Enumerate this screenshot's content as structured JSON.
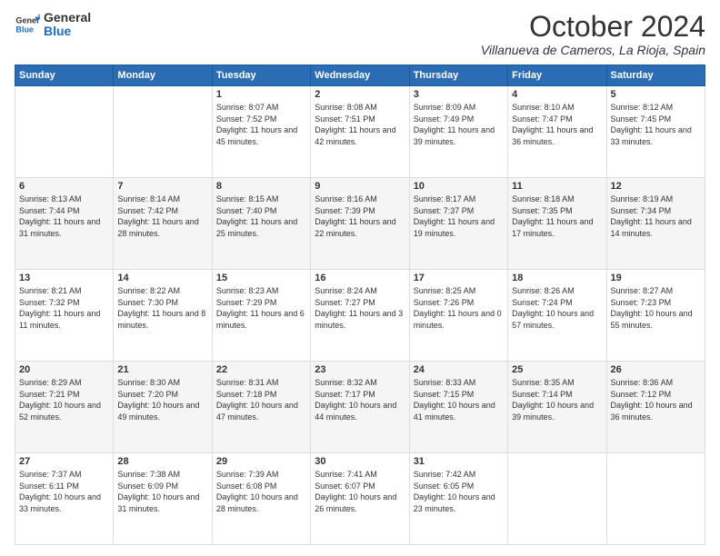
{
  "header": {
    "logo_line1": "General",
    "logo_line2": "Blue",
    "month": "October 2024",
    "location": "Villanueva de Cameros, La Rioja, Spain"
  },
  "weekdays": [
    "Sunday",
    "Monday",
    "Tuesday",
    "Wednesday",
    "Thursday",
    "Friday",
    "Saturday"
  ],
  "weeks": [
    [
      null,
      null,
      {
        "day": 1,
        "sunrise": "8:07 AM",
        "sunset": "7:52 PM",
        "daylight": "11 hours and 45 minutes."
      },
      {
        "day": 2,
        "sunrise": "8:08 AM",
        "sunset": "7:51 PM",
        "daylight": "11 hours and 42 minutes."
      },
      {
        "day": 3,
        "sunrise": "8:09 AM",
        "sunset": "7:49 PM",
        "daylight": "11 hours and 39 minutes."
      },
      {
        "day": 4,
        "sunrise": "8:10 AM",
        "sunset": "7:47 PM",
        "daylight": "11 hours and 36 minutes."
      },
      {
        "day": 5,
        "sunrise": "8:12 AM",
        "sunset": "7:45 PM",
        "daylight": "11 hours and 33 minutes."
      }
    ],
    [
      {
        "day": 6,
        "sunrise": "8:13 AM",
        "sunset": "7:44 PM",
        "daylight": "11 hours and 31 minutes."
      },
      {
        "day": 7,
        "sunrise": "8:14 AM",
        "sunset": "7:42 PM",
        "daylight": "11 hours and 28 minutes."
      },
      {
        "day": 8,
        "sunrise": "8:15 AM",
        "sunset": "7:40 PM",
        "daylight": "11 hours and 25 minutes."
      },
      {
        "day": 9,
        "sunrise": "8:16 AM",
        "sunset": "7:39 PM",
        "daylight": "11 hours and 22 minutes."
      },
      {
        "day": 10,
        "sunrise": "8:17 AM",
        "sunset": "7:37 PM",
        "daylight": "11 hours and 19 minutes."
      },
      {
        "day": 11,
        "sunrise": "8:18 AM",
        "sunset": "7:35 PM",
        "daylight": "11 hours and 17 minutes."
      },
      {
        "day": 12,
        "sunrise": "8:19 AM",
        "sunset": "7:34 PM",
        "daylight": "11 hours and 14 minutes."
      }
    ],
    [
      {
        "day": 13,
        "sunrise": "8:21 AM",
        "sunset": "7:32 PM",
        "daylight": "11 hours and 11 minutes."
      },
      {
        "day": 14,
        "sunrise": "8:22 AM",
        "sunset": "7:30 PM",
        "daylight": "11 hours and 8 minutes."
      },
      {
        "day": 15,
        "sunrise": "8:23 AM",
        "sunset": "7:29 PM",
        "daylight": "11 hours and 6 minutes."
      },
      {
        "day": 16,
        "sunrise": "8:24 AM",
        "sunset": "7:27 PM",
        "daylight": "11 hours and 3 minutes."
      },
      {
        "day": 17,
        "sunrise": "8:25 AM",
        "sunset": "7:26 PM",
        "daylight": "11 hours and 0 minutes."
      },
      {
        "day": 18,
        "sunrise": "8:26 AM",
        "sunset": "7:24 PM",
        "daylight": "10 hours and 57 minutes."
      },
      {
        "day": 19,
        "sunrise": "8:27 AM",
        "sunset": "7:23 PM",
        "daylight": "10 hours and 55 minutes."
      }
    ],
    [
      {
        "day": 20,
        "sunrise": "8:29 AM",
        "sunset": "7:21 PM",
        "daylight": "10 hours and 52 minutes."
      },
      {
        "day": 21,
        "sunrise": "8:30 AM",
        "sunset": "7:20 PM",
        "daylight": "10 hours and 49 minutes."
      },
      {
        "day": 22,
        "sunrise": "8:31 AM",
        "sunset": "7:18 PM",
        "daylight": "10 hours and 47 minutes."
      },
      {
        "day": 23,
        "sunrise": "8:32 AM",
        "sunset": "7:17 PM",
        "daylight": "10 hours and 44 minutes."
      },
      {
        "day": 24,
        "sunrise": "8:33 AM",
        "sunset": "7:15 PM",
        "daylight": "10 hours and 41 minutes."
      },
      {
        "day": 25,
        "sunrise": "8:35 AM",
        "sunset": "7:14 PM",
        "daylight": "10 hours and 39 minutes."
      },
      {
        "day": 26,
        "sunrise": "8:36 AM",
        "sunset": "7:12 PM",
        "daylight": "10 hours and 36 minutes."
      }
    ],
    [
      {
        "day": 27,
        "sunrise": "7:37 AM",
        "sunset": "6:11 PM",
        "daylight": "10 hours and 33 minutes."
      },
      {
        "day": 28,
        "sunrise": "7:38 AM",
        "sunset": "6:09 PM",
        "daylight": "10 hours and 31 minutes."
      },
      {
        "day": 29,
        "sunrise": "7:39 AM",
        "sunset": "6:08 PM",
        "daylight": "10 hours and 28 minutes."
      },
      {
        "day": 30,
        "sunrise": "7:41 AM",
        "sunset": "6:07 PM",
        "daylight": "10 hours and 26 minutes."
      },
      {
        "day": 31,
        "sunrise": "7:42 AM",
        "sunset": "6:05 PM",
        "daylight": "10 hours and 23 minutes."
      },
      null,
      null
    ]
  ]
}
